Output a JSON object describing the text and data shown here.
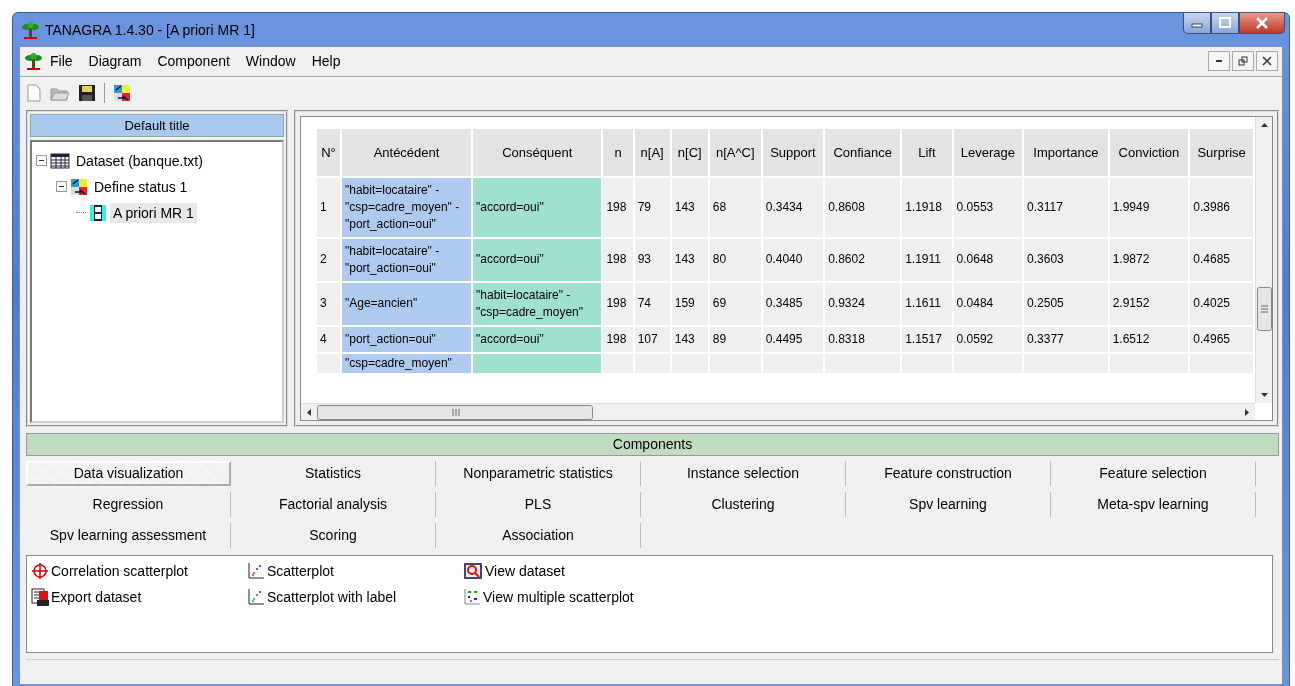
{
  "window": {
    "title": "TANAGRA 1.4.30 - [A priori MR 1]"
  },
  "menu": [
    "File",
    "Diagram",
    "Component",
    "Window",
    "Help"
  ],
  "tree": {
    "title": "Default title",
    "nodes": [
      {
        "label": "Dataset (banque.txt)",
        "expanded": true,
        "selected": false,
        "children": [
          {
            "label": "Define status 1",
            "expanded": true,
            "selected": false,
            "children": [
              {
                "label": "A priori MR 1",
                "selected": true
              }
            ]
          }
        ]
      }
    ]
  },
  "table": {
    "columns": [
      "N°",
      "Antécédent",
      "Conséquent",
      "n",
      "n[A]",
      "n[C]",
      "n[A^C]",
      "Support",
      "Confiance",
      "Lift",
      "Leverage",
      "Importance",
      "Conviction",
      "Surprise"
    ],
    "rows": [
      [
        "1",
        "\"habit=locataire\" - \"csp=cadre_moyen\" - \"port_action=oui\"",
        "\"accord=oui\"",
        "198",
        "79",
        "143",
        "68",
        "0.3434",
        "0.8608",
        "1.1918",
        "0.0553",
        "0.3117",
        "1.9949",
        "0.3986"
      ],
      [
        "2",
        "\"habit=locataire\" - \"port_action=oui\"",
        "\"accord=oui\"",
        "198",
        "93",
        "143",
        "80",
        "0.4040",
        "0.8602",
        "1.1911",
        "0.0648",
        "0.3603",
        "1.9872",
        "0.4685"
      ],
      [
        "3",
        "\"Age=ancien\"",
        "\"habit=locataire\" - \"csp=cadre_moyen\"",
        "198",
        "74",
        "159",
        "69",
        "0.3485",
        "0.9324",
        "1.1611",
        "0.0484",
        "0.2505",
        "2.9152",
        "0.4025"
      ],
      [
        "4",
        "\"port_action=oui\"",
        "\"accord=oui\"",
        "198",
        "107",
        "143",
        "89",
        "0.4495",
        "0.8318",
        "1.1517",
        "0.0592",
        "0.3377",
        "1.6512",
        "0.4965"
      ],
      [
        "",
        "\"csp=cadre_moyen\"",
        "",
        "",
        "",
        "",
        "",
        "",
        "",
        "",
        "",
        "",
        "",
        ""
      ]
    ]
  },
  "components": {
    "title": "Components",
    "tabs": [
      {
        "label": "Data visualization",
        "selected": true
      },
      {
        "label": "Statistics",
        "selected": false
      },
      {
        "label": "Nonparametric statistics",
        "selected": false
      },
      {
        "label": "Instance selection",
        "selected": false
      },
      {
        "label": "Feature construction",
        "selected": false
      },
      {
        "label": "Feature selection",
        "selected": false
      },
      {
        "label": "Regression",
        "selected": false
      },
      {
        "label": "Factorial analysis",
        "selected": false
      },
      {
        "label": "PLS",
        "selected": false
      },
      {
        "label": "Clustering",
        "selected": false
      },
      {
        "label": "Spv learning",
        "selected": false
      },
      {
        "label": "Meta-spv learning",
        "selected": false
      },
      {
        "label": "Spv learning assessment",
        "selected": false
      },
      {
        "label": "Scoring",
        "selected": false
      },
      {
        "label": "Association",
        "selected": false
      }
    ],
    "items": [
      "Correlation scatterplot",
      "Export dataset",
      "Scatterplot",
      "Scatterplot with label",
      "View dataset",
      "View multiple scatterplot"
    ]
  }
}
